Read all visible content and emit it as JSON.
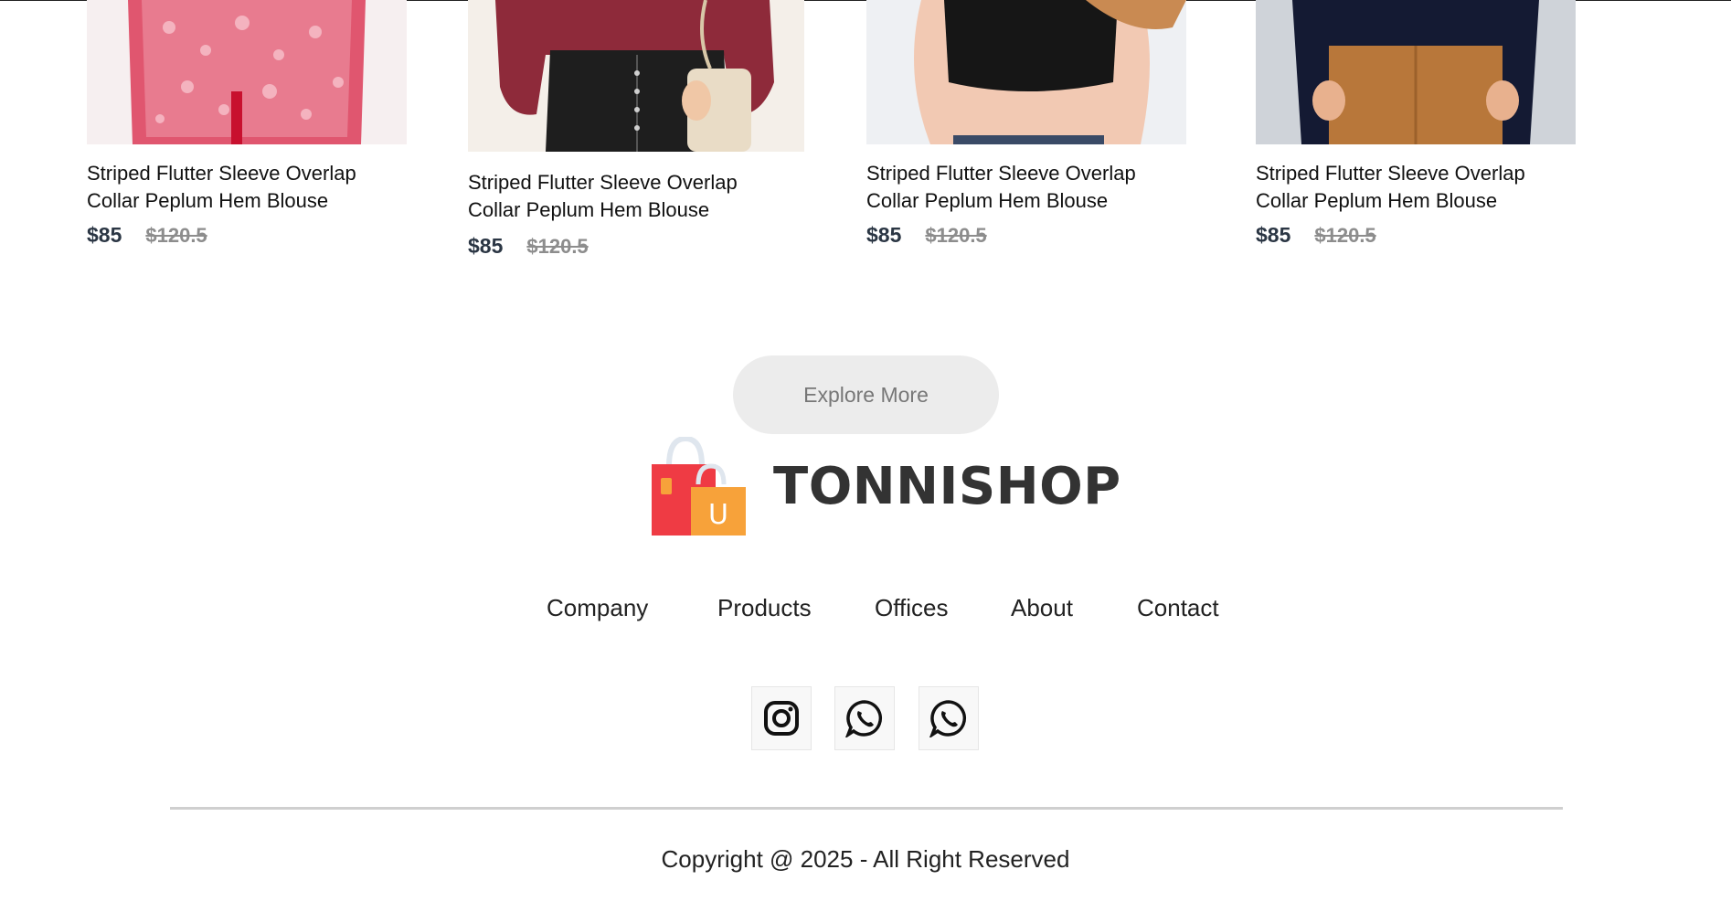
{
  "products": [
    {
      "title_line1": "Striped Flutter Sleeve Overlap",
      "title_line2": "Collar Peplum Hem Blouse",
      "price": "$85",
      "old_price": "$120.5",
      "image": "floral-pink-blouse"
    },
    {
      "title_line1": "Striped Flutter Sleeve Overlap",
      "title_line2": "Collar Peplum Hem Blouse",
      "price": "$85",
      "old_price": "$120.5",
      "image": "maroon-blouse-leather-skirt"
    },
    {
      "title_line1": "Striped Flutter Sleeve Overlap",
      "title_line2": "Collar Peplum Hem Blouse",
      "price": "$85",
      "old_price": "$120.5",
      "image": "black-crop-top"
    },
    {
      "title_line1": "Striped Flutter Sleeve Overlap",
      "title_line2": "Collar Peplum Hem Blouse",
      "price": "$85",
      "old_price": "$120.5",
      "image": "navy-top-tan-skirt"
    }
  ],
  "explore_button": "Explore More",
  "brand": {
    "name": "TONNISHOP",
    "logo_icon": "shopping-bags-icon",
    "logo_letter": "U"
  },
  "footer_nav": [
    "Company",
    "Products",
    "Offices",
    "About",
    "Contact"
  ],
  "social": [
    {
      "icon": "instagram-icon"
    },
    {
      "icon": "whatsapp-icon"
    },
    {
      "icon": "whatsapp-icon"
    }
  ],
  "copyright": "Copyright @ 2025 - All Right Reserved",
  "colors": {
    "price": "#2b3644",
    "old_price": "#8d8d8d",
    "button_bg": "#ececec",
    "bag_red": "#ef3b44",
    "bag_orange": "#f7a23a"
  }
}
